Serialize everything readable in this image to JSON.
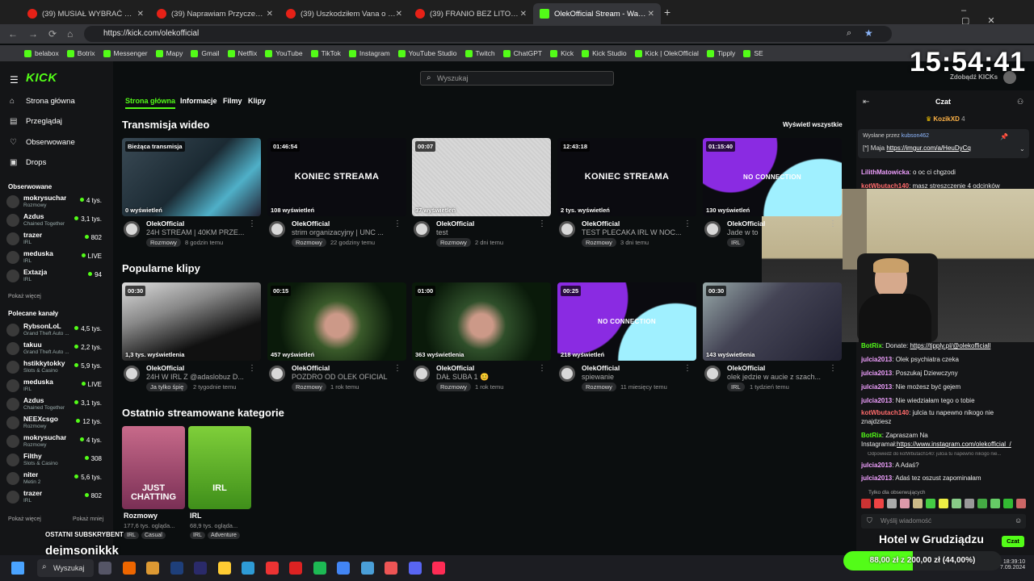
{
  "tabs": [
    {
      "title": "(39) MUSIAŁ WYBRAĆ KOGO U"
    },
    {
      "title": "(39) Naprawiam Przyczepę Kem"
    },
    {
      "title": "(39) Uszkodziłem Vana o Słup E"
    },
    {
      "title": "(39) FRANIO BEZ LITOŚCI NAD"
    },
    {
      "title": "OlekOfficial Stream - Watch"
    }
  ],
  "url": "https://kick.com/olekofficial",
  "bookmarks": [
    "belabox",
    "Botrix",
    "Messenger",
    "Mapy",
    "Gmail",
    "Netflix",
    "YouTube",
    "TikTok",
    "Instagram",
    "YouTube Studio",
    "Twitch",
    "ChatGPT",
    "Kick",
    "Kick Studio",
    "Kick | OlekOfficial",
    "Tipply",
    "SE"
  ],
  "overlay": {
    "clock": "15:54:41",
    "last_sub_label": "OSTATNI SUBSKRYBENT",
    "last_sub_name": "dejmsonikkk",
    "goal_title": "Hotel w Grudziądzu",
    "goal_progress": "88,00 zł z 200,00 zł (44,00%)",
    "goal_fraction": 0.44
  },
  "site": {
    "logo": "KICK",
    "search_placeholder": "Wyszukaj",
    "get_kicks": "Zdobądź KICKs"
  },
  "sidebar": {
    "nav": [
      "Strona główna",
      "Przeglądaj",
      "Obserwowane",
      "Drops"
    ],
    "followed_title": "Obserwowane",
    "followed": [
      {
        "name": "mokrysuchar",
        "cat": "Rozmowy",
        "viewers": "4 tys."
      },
      {
        "name": "Azdus",
        "cat": "Chained Together",
        "viewers": "3,1 tys."
      },
      {
        "name": "trazer",
        "cat": "IRL",
        "viewers": "802"
      },
      {
        "name": "meduska",
        "cat": "IRL",
        "viewers": "LIVE"
      },
      {
        "name": "Extazja",
        "cat": "IRL",
        "viewers": "94"
      }
    ],
    "show_more_1": "Pokaż więcej",
    "recommended_title": "Polecane kanały",
    "recommended": [
      {
        "name": "RybsonLoL",
        "cat": "Grand Theft Auto ...",
        "viewers": "4,5 tys."
      },
      {
        "name": "takuu",
        "cat": "Grand Theft Auto ...",
        "viewers": "2,2 tys."
      },
      {
        "name": "hstikkytokky",
        "cat": "Slots & Casino",
        "viewers": "5,9 tys."
      },
      {
        "name": "meduska",
        "cat": "IRL",
        "viewers": "LIVE"
      },
      {
        "name": "Azdus",
        "cat": "Chained Together",
        "viewers": "3,1 tys."
      },
      {
        "name": "NEEXcsgo",
        "cat": "Rozmowy",
        "viewers": "12 tys."
      },
      {
        "name": "mokrysuchar",
        "cat": "Rozmowy",
        "viewers": "4 tys."
      },
      {
        "name": "Filthy",
        "cat": "Slots & Casino",
        "viewers": "308"
      },
      {
        "name": "niter",
        "cat": "Metin 2",
        "viewers": "5,6 tys."
      },
      {
        "name": "trazer",
        "cat": "IRL",
        "viewers": "802"
      }
    ],
    "show_more_2": "Pokaż więcej",
    "show_less": "Pokaż mniej"
  },
  "main": {
    "subtabs": [
      "Strona główna",
      "Informacje",
      "Filmy",
      "Klipy"
    ],
    "videos_title": "Transmisja wideo",
    "view_all": "Wyświetl wszystkie",
    "videos": [
      {
        "top": "Bieżąca transmisja",
        "views": "0 wyświetleń",
        "channel": "OlekOfficial",
        "title": "24H STREAM | 40KM PRZE...",
        "tag": "Rozmowy",
        "ago": "8 godzin temu"
      },
      {
        "top": "01:46:54",
        "views": "108 wyświetleń",
        "channel": "OlekOfficial",
        "title": "strim organizacyjny | UNC ...",
        "tag": "Rozmowy",
        "ago": "22 godziny temu",
        "ended": "KONIEC STREAMA"
      },
      {
        "top": "00:07",
        "views": "37 wyświetleń",
        "channel": "OlekOfficial",
        "title": "test",
        "tag": "Rozmowy",
        "ago": "2 dni temu"
      },
      {
        "top": "12:43:18",
        "views": "2 tys. wyświetleń",
        "channel": "OlekOfficial",
        "title": "TEST PLECAKA IRL W NOC...",
        "tag": "Rozmowy",
        "ago": "3 dni temu",
        "ended": "KONIEC STREAMA"
      },
      {
        "top": "01:15:40",
        "views": "130 wyświetleń",
        "channel": "OlekOfficial",
        "title": "Jade w to",
        "tag": "IRL",
        "ago": "",
        "ended": "NO CONNECTION"
      }
    ],
    "clips_title": "Popularne klipy",
    "clips": [
      {
        "top": "00:30",
        "views": "1,3 tys. wyświetlenia",
        "channel": "OlekOfficial",
        "title": "24H W IRL Z @adaslobuz D...",
        "tag": "Ja tylko śpię",
        "ago": "2 tygodnie temu"
      },
      {
        "top": "00:15",
        "views": "457 wyświetleń",
        "channel": "OlekOfficial",
        "title": "POZDRO OD OLEK OFICIAL",
        "tag": "Rozmowy",
        "ago": "1 rok temu"
      },
      {
        "top": "01:00",
        "views": "363 wyświetlenia",
        "channel": "OlekOfficial",
        "title": "DAŁ SUBA 1 😊",
        "tag": "Rozmowy",
        "ago": "1 rok temu"
      },
      {
        "top": "00:25",
        "views": "218 wyświetleń",
        "channel": "OlekOfficial",
        "title": "spiewanie",
        "tag": "Rozmowy",
        "ago": "11 miesięcy temu",
        "ended": "NO CONNECTION"
      },
      {
        "top": "00:30",
        "views": "143 wyświetlenia",
        "channel": "OlekOfficial",
        "title": "olek jedzie w aucie z szach...",
        "tag": "IRL",
        "ago": "1 tydzień temu"
      }
    ],
    "categories_title": "Ostatnio streamowane kategorie",
    "categories": [
      {
        "name": "Rozmowy",
        "views": "177,6 tys. ogląda...",
        "tags": [
          "IRL",
          "Casual"
        ],
        "art": "JUST CHATTING"
      },
      {
        "name": "IRL",
        "views": "68,9 tys. ogląda...",
        "tags": [
          "IRL",
          "Adventure"
        ],
        "art": "IRL"
      }
    ]
  },
  "chat": {
    "title": "Czat",
    "pinned_top_user": "KozikXD",
    "pinned_top_val": "4",
    "pinned_sender_label": "Wysłane przez",
    "pinned_sender": "kubson462",
    "pinned_user": "Maja",
    "pinned_msg": "[*] Maja",
    "pinned_link": "https://imgur.com/a/HeuDyCq",
    "messages": [
      {
        "user": "LilithMatowicka",
        "text": ": o oc ci chgzodi"
      },
      {
        "user": "kotWbutach140",
        "text": ": masz streszczenie 4 odcinków"
      },
      {
        "user": "BotRix",
        "text": ": Donate: ",
        "link": "https://tipply.pl/@olekofficiall"
      },
      {
        "user": "julcia2013",
        "text": ": Olek psychiatra czeka"
      },
      {
        "user": "julcia2013",
        "text": ": Poszukaj Dziewczyny"
      },
      {
        "user": "julcia2013",
        "text": ": Nie możesz być gejem"
      },
      {
        "user": "julcia2013",
        "text": ": Nie wiedziałam tego o tobie"
      },
      {
        "user": "kotWbutach140",
        "text": ": julcia tu napewno nikogo nie znajdziesz"
      },
      {
        "user": "BotRix",
        "text": ": Zapraszam Na Instagramał:",
        "link": "https://www.instagram.com/olekofficial_/"
      },
      {
        "user": "julcia2013",
        "text": ": A Adaś?",
        "reply": "Odpowiedź do kotWbutach140: julcia tu napewno nikogo nie..."
      },
      {
        "user": "julcia2013",
        "text": ": Adaś tez oszust zapominałam"
      }
    ],
    "followers_only": "Tylko dla obserwujących",
    "input_placeholder": "Wyślij wiadomość",
    "send": "Czat"
  },
  "taskbar": {
    "search": "Wyszukaj",
    "time": "18:39:10",
    "date": "7.09.2024"
  }
}
